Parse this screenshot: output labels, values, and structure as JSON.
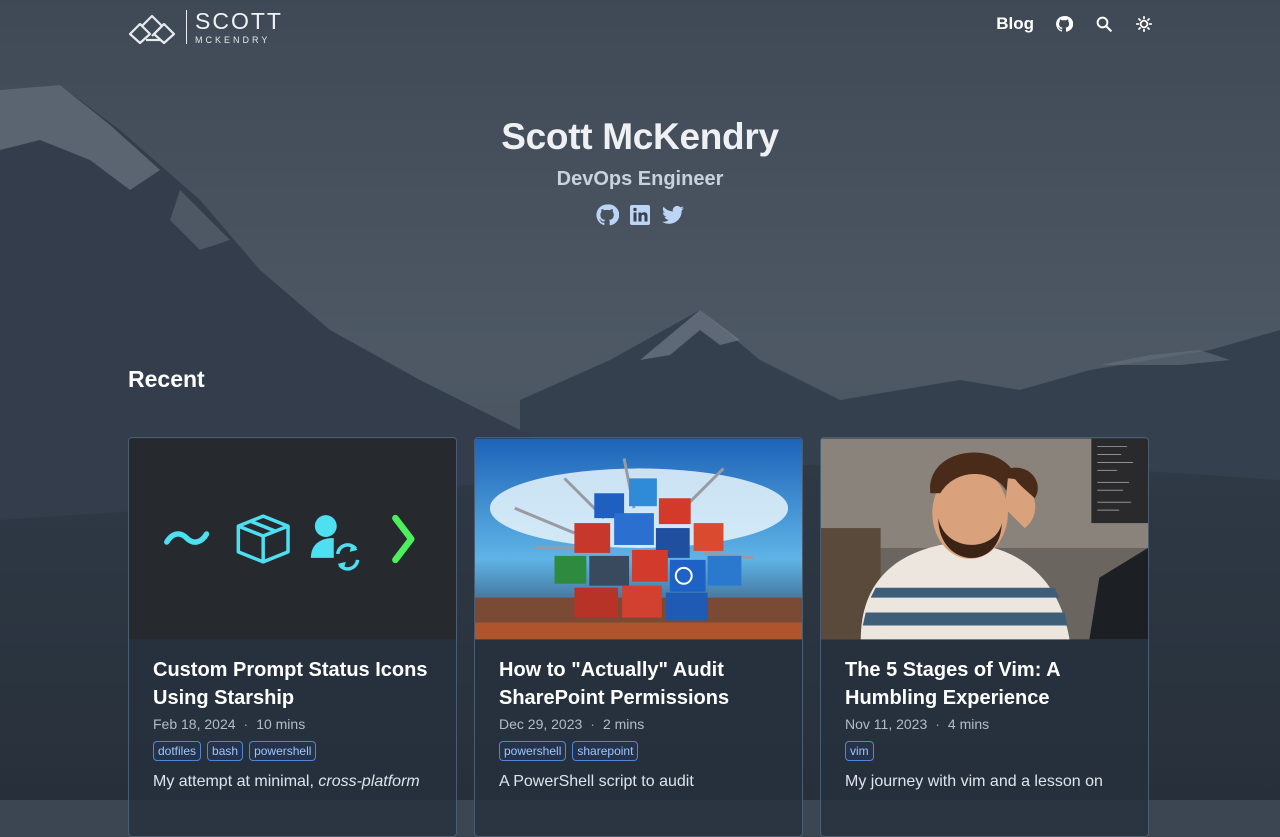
{
  "site": {
    "logo_name": "SCOTT",
    "logo_sub": "MCKENDRY",
    "nav": {
      "blog_label": "Blog",
      "icons": [
        "github-icon",
        "search-icon",
        "theme-toggle-icon"
      ]
    }
  },
  "hero": {
    "name": "Scott McKendry",
    "title": "DevOps Engineer",
    "social": [
      "github-icon",
      "linkedin-icon",
      "twitter-icon"
    ]
  },
  "recent": {
    "heading": "Recent",
    "posts": [
      {
        "title": "Custom Prompt Status Icons Using Starship",
        "date": "Feb 18, 2024",
        "read_time": "10 mins",
        "tags": [
          "dotfiles",
          "bash",
          "powershell"
        ],
        "desc_prefix": "My attempt at minimal, ",
        "desc_em": "cross-platform",
        "image_icons": [
          "tilde-icon",
          "package-icon",
          "user-sync-icon",
          "prompt-chevron-icon"
        ]
      },
      {
        "title": "How to \"Actually\" Audit SharePoint Permissions",
        "date": "Dec 29, 2023",
        "read_time": "2 mins",
        "tags": [
          "powershell",
          "sharepoint"
        ],
        "desc": "A PowerShell script to audit"
      },
      {
        "title": "The 5 Stages of Vim: A Humbling Experience",
        "date": "Nov 11, 2023",
        "read_time": "4 mins",
        "tags": [
          "vim"
        ],
        "desc": "My journey with vim and a lesson on"
      }
    ]
  },
  "colors": {
    "accent_tag": "#4f86d8",
    "icon_cyan": "#4ee0f0",
    "icon_green": "#4cf05a",
    "social_blue": "#bcd4f5"
  }
}
